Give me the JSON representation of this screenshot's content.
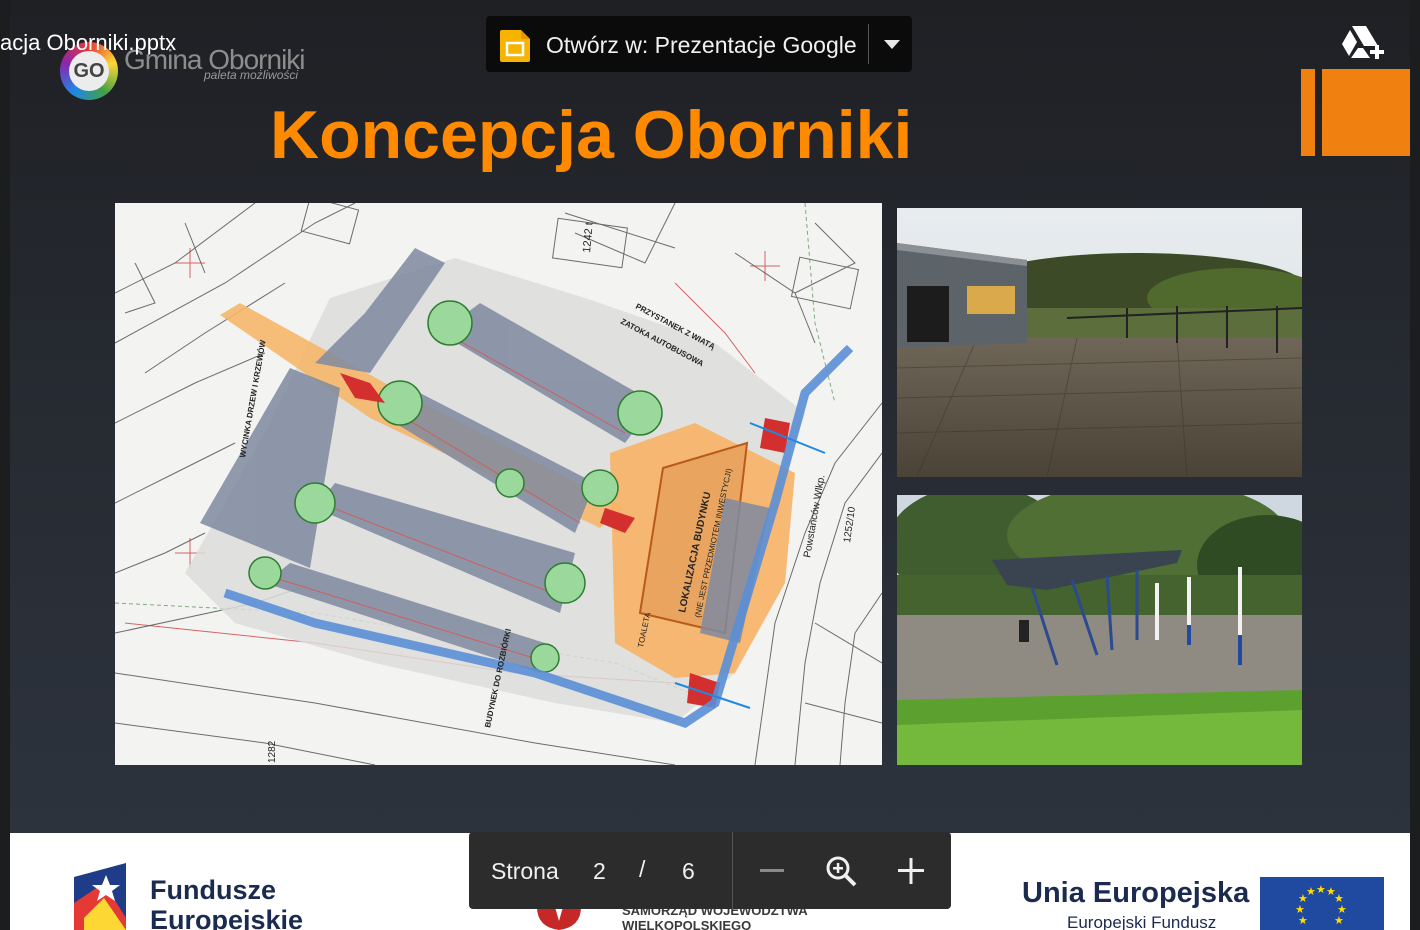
{
  "viewer": {
    "file_name": "acja Oborniki.pptx",
    "open_with_label": "Otwórz w: Prezentacje Google",
    "open_menu_icon": "chevron-down-icon",
    "slides_app_icon": "google-slides-icon",
    "add_to_drive_icon": "drive-add-icon"
  },
  "slide": {
    "logo_badge": "GO",
    "logo_name": "Gmina Oborniki",
    "logo_tagline": "paleta możliwości",
    "title": "Koncepcja Oborniki",
    "accent_color": "#ff8a00",
    "map_alt": "site plan",
    "map_labels": {
      "building_location": "LOKALIZACJA BUDYNKU",
      "investment_note": "(NIE JEST PRZEDMIOTEM INWESTYCJI)",
      "toilet": "TOALETA",
      "bus_bay": "ZATOKA AUTOBUSOWA",
      "bus_shelter": "PRZYSTANEK Z WIATĄ",
      "building_demolition": "BUDYNEK DO ROZBIÓRKI",
      "street": "Powstańców Wlkp.",
      "parcel": "1252/10",
      "parcel2": "1242 t",
      "parcel3": "1282",
      "tree_removal": "WYCINKA DRZEW I KRZEWÓW"
    },
    "footer": {
      "fe_line1": "Fundusze",
      "fe_line2": "Europejskie",
      "region_line1": "SAMORZĄD WOJEWÓDZTWA",
      "region_line2": "WIELKOPOLSKIEGO",
      "eu_line1": "Unia Europejska",
      "eu_line2": "Europejski Fundusz"
    }
  },
  "pager": {
    "label": "Strona",
    "current": "2",
    "separator": "/",
    "total": "6",
    "zoom_out_icon": "minus-icon",
    "zoom_icon": "magnifier-icon",
    "zoom_in_icon": "plus-icon"
  }
}
